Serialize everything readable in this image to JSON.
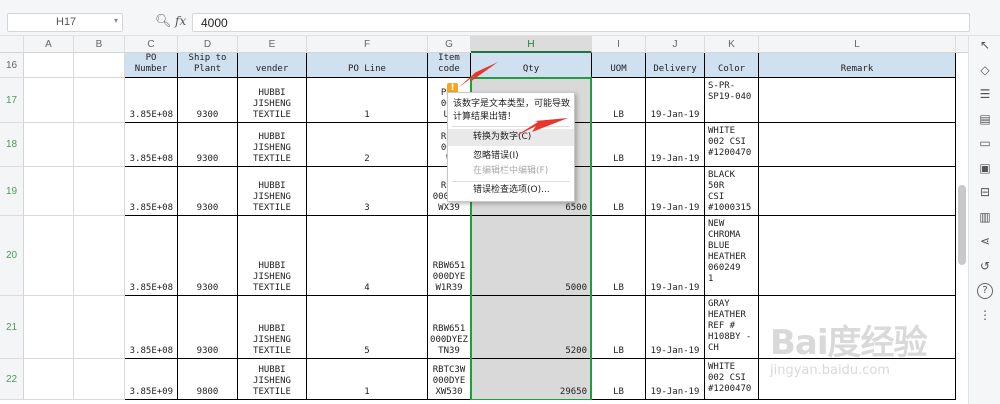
{
  "formula_bar": {
    "name_box": "H17",
    "zoom_icon": "magnifier-icon",
    "fx": "fx",
    "value": "4000"
  },
  "columns": [
    "A",
    "B",
    "C",
    "D",
    "E",
    "F",
    "G",
    "H",
    "I",
    "J",
    "K",
    "L"
  ],
  "selected_column": "H",
  "header_row": {
    "row": "16",
    "po_number": "PO\nNumber",
    "ship_to": "Ship to\nPlant",
    "vender": "vender",
    "po_line": "PO Line",
    "item_code": "Item\ncode",
    "qty": "Qty",
    "uom": "UOM",
    "delivery": "Delivery",
    "color": "Color",
    "remark": "Remark"
  },
  "rows": [
    {
      "row": "17",
      "po": "3.85E+08",
      "ship": "9300",
      "vender": "HUBBI\nJISHENG\nTEXTILE",
      "line": "1",
      "item": "PRU\n000\nUC",
      "qty": "",
      "uom": "LB",
      "delivery": "19-Jan-19",
      "color": "S-PR-\nSP19-040"
    },
    {
      "row": "18",
      "po": "3.85E+08",
      "ship": "9300",
      "vender": "HUBBI\nJISHENG\nTEXTILE",
      "line": "2",
      "item": "RBV\n000\nW",
      "qty": "",
      "uom": "LB",
      "delivery": "19-Jan-19",
      "color": "WHITE\n002 CSI\n#1200470"
    },
    {
      "row": "19",
      "po": "3.85E+08",
      "ship": "9300",
      "vender": "HUBBI\nJISHENG\nTEXTILE",
      "line": "3",
      "item": "RBU\n000DYE\nWX39",
      "qty": "6500",
      "uom": "LB",
      "delivery": "19-Jan-19",
      "color": "BLACK\n50R\nCSI\n#1000315"
    },
    {
      "row": "20",
      "po": "3.85E+08",
      "ship": "9300",
      "vender": "HUBBI\nJISHENG\nTEXTILE",
      "line": "4",
      "item": "RBW651\n000DYE\nW1R39",
      "qty": "5000",
      "uom": "LB",
      "delivery": "19-Jan-19",
      "color": "NEW\nCHROMA\nBLUE\nHEATHER\n 060249\n1"
    },
    {
      "row": "21",
      "po": "3.85E+08",
      "ship": "9300",
      "vender": "HUBBI\nJISHENG\nTEXTILE",
      "line": "5",
      "item": "RBW651\n000DYEZ\nTN39",
      "qty": "5200",
      "uom": "LB",
      "delivery": "19-Jan-19",
      "color": "GRAY\nHEATHER\nREF #\nH108BY -\nCH"
    },
    {
      "row": "22",
      "po": "3.85E+09",
      "ship": "9800",
      "vender": "HUBBI\nJISHENG\nTEXTILE",
      "line": "1",
      "item": "RBTC3W\n000DYE\nXW530",
      "qty": "29650",
      "uom": "LB",
      "delivery": "19-Jan-19",
      "color": "WHITE\n002 CSI\n#1200470"
    }
  ],
  "popup": {
    "warning_icon": "warning-icon",
    "warning_glyph": "!",
    "message": "该数字是文本类型，可能导致计算结果出错！",
    "items": [
      "转换为数字(C)",
      "忽略错误(I)",
      "在编辑栏中编辑(F)",
      "错误检查选项(O)..."
    ]
  },
  "right_panel_icons": [
    "cursor-icon",
    "shapes-icon",
    "properties-icon",
    "format-icon",
    "note-icon",
    "image-gallery-icon",
    "table-style-icon",
    "chart-icon",
    "share-icon",
    "history-icon",
    "help-icon",
    "more-icon"
  ],
  "watermark": {
    "logo": "Bai度经验",
    "url": "jingyan.baidu.com"
  },
  "colors": {
    "header_blue": "#cfe0f1",
    "selection_green": "#1e9e3c",
    "arrow_red": "#e8362b",
    "qty_grey": "#d9d9d9"
  }
}
